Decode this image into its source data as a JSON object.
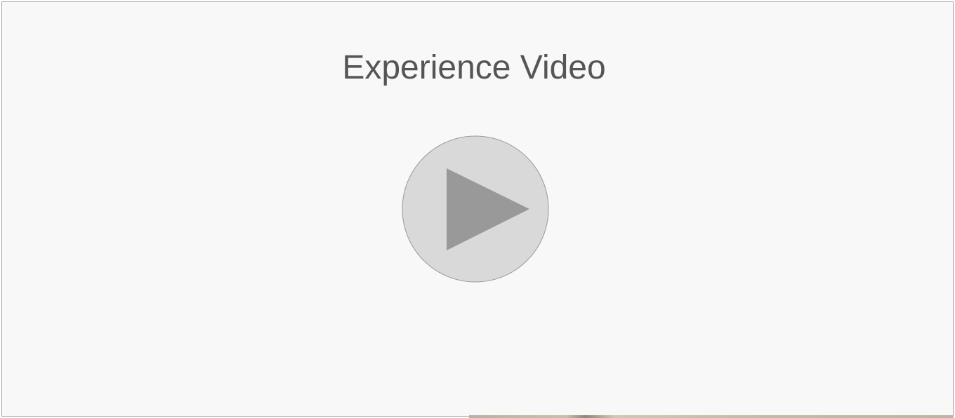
{
  "video": {
    "title": "Experience Video",
    "play_icon": "play-icon"
  },
  "colors": {
    "background": "#f8f8f8",
    "border": "#a6a6a6",
    "title_text": "#555555",
    "play_circle_fill": "#d9d9d9",
    "play_circle_stroke": "#999999",
    "play_triangle": "#999999"
  }
}
